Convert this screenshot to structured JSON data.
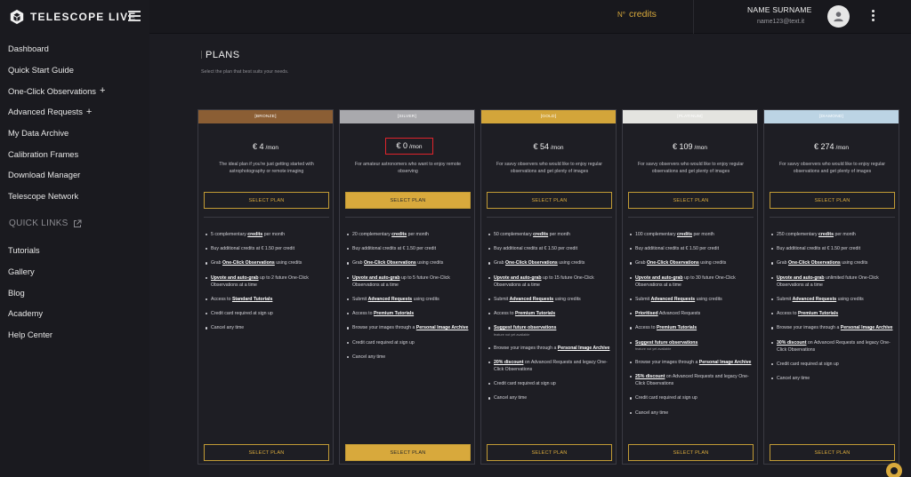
{
  "brand": {
    "name": "TELESCOPE LIVE"
  },
  "sidebar": {
    "items": [
      {
        "label": "Dashboard",
        "plus": ""
      },
      {
        "label": "Quick Start Guide",
        "plus": ""
      },
      {
        "label": "One-Click Observations",
        "plus": "+"
      },
      {
        "label": "Advanced Requests",
        "plus": "+"
      },
      {
        "label": "My Data Archive",
        "plus": ""
      },
      {
        "label": "Calibration Frames",
        "plus": ""
      },
      {
        "label": "Download Manager",
        "plus": ""
      },
      {
        "label": "Telescope Network",
        "plus": ""
      }
    ],
    "quick_links_label": "QUICK LINKS",
    "quick_links": [
      {
        "label": "Tutorials"
      },
      {
        "label": "Gallery"
      },
      {
        "label": "Blog"
      },
      {
        "label": "Academy"
      },
      {
        "label": "Help Center"
      }
    ]
  },
  "topbar": {
    "credits_prefix": "N°",
    "credits_label": "credits",
    "user_name": "NAME SURNAME",
    "user_email": "name123@text.it"
  },
  "page": {
    "title": "PLANS",
    "subtitle": "Select the plan that best suits your needs."
  },
  "plans": [
    {
      "tier": "[BRONZE]",
      "color": "#8b5e34",
      "price": "€ 4",
      "period": "/mon",
      "boxed": false,
      "description": "The ideal plan if you're just getting started with astrophotography or remote imaging",
      "select_label": "SELECT PLAN",
      "featured": false,
      "features": [
        [
          {
            "t": "5 complementary "
          },
          {
            "t": "credits",
            "u": true
          },
          {
            "t": " per month"
          }
        ],
        [
          {
            "t": "Buy additional credits at € 1.50 per credit"
          }
        ],
        [
          {
            "t": "Grab "
          },
          {
            "t": "One-Click Observations",
            "u": true
          },
          {
            "t": " using credits"
          }
        ],
        [
          {
            "t": "Upvote and auto-grab",
            "u": true
          },
          {
            "t": " up to 2 future One-Click Observations at a time"
          }
        ],
        [
          {
            "t": "Access to "
          },
          {
            "t": "Standard Tutorials",
            "u": true
          }
        ],
        [
          {
            "t": "Credit card required at sign up"
          }
        ],
        [
          {
            "t": "Cancel any time"
          }
        ]
      ]
    },
    {
      "tier": "[SILVER]",
      "color": "#a9a9ad",
      "price": "€ 0",
      "period": "/mon",
      "boxed": true,
      "description": "For amateur astronomers who want to enjoy remote observing",
      "select_label": "SELECT PLAN",
      "featured": true,
      "features": [
        [
          {
            "t": "20 complementary "
          },
          {
            "t": "credits",
            "u": true
          },
          {
            "t": " per month"
          }
        ],
        [
          {
            "t": "Buy additional credits at € 1.50 per credit"
          }
        ],
        [
          {
            "t": "Grab "
          },
          {
            "t": "One-Click Observations",
            "u": true
          },
          {
            "t": " using credits"
          }
        ],
        [
          {
            "t": "Upvote and auto-grab",
            "u": true
          },
          {
            "t": " up to 5 future One-Click Observations at a time"
          }
        ],
        [
          {
            "t": "Submit "
          },
          {
            "t": "Advanced Requests",
            "u": true
          },
          {
            "t": " using credits"
          }
        ],
        [
          {
            "t": "Access to "
          },
          {
            "t": "Premium Tutorials",
            "u": true
          }
        ],
        [
          {
            "t": "Browse your images through a "
          },
          {
            "t": "Personal Image Archive",
            "u": true
          }
        ],
        [
          {
            "t": "Credit card required at sign up"
          }
        ],
        [
          {
            "t": "Cancel any time"
          }
        ]
      ]
    },
    {
      "tier": "[GOLD]",
      "color": "#d3a53a",
      "price": "€ 54",
      "period": "/mon",
      "boxed": false,
      "description": "For savvy observers who would like to enjoy regular observations and get plenty of images",
      "select_label": "SELECT PLAN",
      "featured": false,
      "features": [
        [
          {
            "t": "50 complementary "
          },
          {
            "t": "credits",
            "u": true
          },
          {
            "t": " per month"
          }
        ],
        [
          {
            "t": "Buy additional credits at € 1.50 per credit"
          }
        ],
        [
          {
            "t": "Grab "
          },
          {
            "t": "One-Click Observations",
            "u": true
          },
          {
            "t": " using credits"
          }
        ],
        [
          {
            "t": "Upvote and auto-grab",
            "u": true
          },
          {
            "t": " up to 15 future One-Click Observations at a time"
          }
        ],
        [
          {
            "t": "Submit "
          },
          {
            "t": "Advanced Requests",
            "u": true
          },
          {
            "t": " using credits"
          }
        ],
        [
          {
            "t": "Access to "
          },
          {
            "t": "Premium Tutorials",
            "u": true
          }
        ],
        [
          {
            "t": "Suggest future observations",
            "u": true
          },
          {
            "t": "feature not yet available",
            "note": true
          }
        ],
        [
          {
            "t": "Browse your images through a "
          },
          {
            "t": "Personal Image Archive",
            "u": true
          }
        ],
        [
          {
            "t": "20% discount",
            "u": true
          },
          {
            "t": " on Advanced Requests and legacy One-Click Observations"
          }
        ],
        [
          {
            "t": "Credit card required at sign up"
          }
        ],
        [
          {
            "t": "Cancel any time"
          }
        ]
      ]
    },
    {
      "tier": "[PLATINUM]",
      "color": "#e4e4e0",
      "price": "€ 109",
      "period": "/mon",
      "boxed": false,
      "description": "For savvy observers who would like to enjoy regular observations and get plenty of images",
      "select_label": "SELECT PLAN",
      "featured": false,
      "features": [
        [
          {
            "t": "100 complementary "
          },
          {
            "t": "credits",
            "u": true
          },
          {
            "t": " per month"
          }
        ],
        [
          {
            "t": "Buy additional credits at € 1.50 per credit"
          }
        ],
        [
          {
            "t": "Grab "
          },
          {
            "t": "One-Click Observations",
            "u": true
          },
          {
            "t": " using credits"
          }
        ],
        [
          {
            "t": "Upvote and auto-grab",
            "u": true
          },
          {
            "t": " up to 30 future One-Click Observations at a time"
          }
        ],
        [
          {
            "t": "Submit "
          },
          {
            "t": "Advanced Requests",
            "u": true
          },
          {
            "t": " using credits"
          }
        ],
        [
          {
            "t": "Prioritised",
            "u": true
          },
          {
            "t": " Advanced Requests"
          }
        ],
        [
          {
            "t": "Access to "
          },
          {
            "t": "Premium Tutorials",
            "u": true
          }
        ],
        [
          {
            "t": "Suggest future observations",
            "u": true
          },
          {
            "t": "feature not yet available",
            "note": true
          }
        ],
        [
          {
            "t": "Browse your images through a "
          },
          {
            "t": "Personal Image Archive",
            "u": true
          }
        ],
        [
          {
            "t": "25% discount",
            "u": true
          },
          {
            "t": " on Advanced Requests and legacy One-Click Observations"
          }
        ],
        [
          {
            "t": "Credit card required at sign up"
          }
        ],
        [
          {
            "t": "Cancel any time"
          }
        ]
      ]
    },
    {
      "tier": "[DIAMOND]",
      "color": "#bcd4e4",
      "price": "€ 274",
      "period": "/mon",
      "boxed": false,
      "description": "For savvy observers who would like to enjoy regular observations and get plenty of images",
      "select_label": "SELECT PLAN",
      "featured": false,
      "features": [
        [
          {
            "t": "250 complementary "
          },
          {
            "t": "credits",
            "u": true
          },
          {
            "t": " per month"
          }
        ],
        [
          {
            "t": "Buy additional credits at € 1.50 per credit"
          }
        ],
        [
          {
            "t": "Grab "
          },
          {
            "t": "One-Click Observations",
            "u": true
          },
          {
            "t": " using credits"
          }
        ],
        [
          {
            "t": "Upvote and auto-grab",
            "u": true
          },
          {
            "t": " unlimited future One-Click Observations at a time"
          }
        ],
        [
          {
            "t": "Submit "
          },
          {
            "t": "Advanced Requests",
            "u": true
          },
          {
            "t": " using credits"
          }
        ],
        [
          {
            "t": "Access to "
          },
          {
            "t": "Premium Tutorials",
            "u": true
          }
        ],
        [
          {
            "t": "Browse your images through a "
          },
          {
            "t": "Personal Image Archive",
            "u": true
          }
        ],
        [
          {
            "t": "30% discount",
            "u": true
          },
          {
            "t": " on Advanced Requests and legacy One-Click Observations"
          }
        ],
        [
          {
            "t": "Credit card required at sign up"
          }
        ],
        [
          {
            "t": "Cancel any time"
          }
        ]
      ]
    }
  ],
  "colors": {
    "accent": "#d8a93c",
    "highlight_box": "#e0242c",
    "background": "#1c1c22"
  }
}
